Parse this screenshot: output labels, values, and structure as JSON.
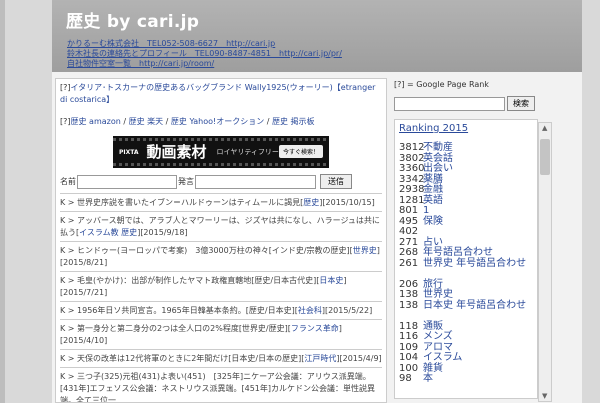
{
  "header": {
    "title": "歴史 by cari.jp",
    "links": [
      "かりるーむ株式会社　TEL052-508-6627　http://cari.jp",
      "鈴木社長の連絡先とプロフィール　TEL090-8487-4851　http://cari.jp/pr/",
      "自社物件空室一覧　http://cari.jp/room/"
    ]
  },
  "main": {
    "promo_prefix": "[?]",
    "promo_link": "イタリア･トスカーナの歴史あるバッグブランド Wally1925(ウォーリー)【etranger di costarica】",
    "amazon_links": {
      "prefix": "[?]",
      "items": [
        "歴史 amazon",
        "歴史 楽天",
        "歴史 Yahoo!オークション",
        "歴史 掲示板"
      ],
      "sep": " / "
    },
    "banner": {
      "brand": "PIXTA",
      "main": "動画素材",
      "sub": "ロイヤリティフリー",
      "button": "今すぐ検索！"
    },
    "form": {
      "name_label": "名前",
      "say_label": "発言",
      "send_label": "送信"
    },
    "posts": [
      {
        "text": "K > 世界史序説を書いたイブン＝ハルドゥーンはティムールに謁見",
        "link": "歴史",
        "tail": "[2015/10/15]"
      },
      {
        "text": "K > アッバース朝では、アラブ人とマワーリーは、ジズヤは共になし、ハラージュは共に払う",
        "link": "イスラム教 歴史",
        "tail": "[2015/9/18]"
      },
      {
        "text": "K > ヒンドゥー(ヨーロッパで考案)　3億3000万柱の神々[インド史/宗教の歴史]",
        "link": "世界史",
        "tail": "[2015/8/21]"
      },
      {
        "text": "K > 毛皇(やかけ)：出部が制作したヤマト政権直轄地[歴史/日本古代史]",
        "link": "日本史",
        "tail": "[2015/7/21]"
      },
      {
        "text": "K > 1956年日ソ共同宣言。1965年日韓基本条約。[歴史/日本史]",
        "link": "社会科",
        "tail": "[2015/5/22]"
      },
      {
        "text": "K > 第一身分と第二身分の2つは全人口の2%程度[世界史/歴史]",
        "link": "フランス革命",
        "tail": "[2015/4/10]"
      },
      {
        "text": "K > 天保の改革は12代将軍のときに2年間だけ[日本史/日本の歴史]",
        "link": "江戸時代",
        "tail": "[2015/4/9]"
      },
      {
        "text": "K > 三つ子(325)元祖(431)よ表い(451)　[325年]ニケーア公会議：アリウス派異端。[431年]エフェソス公会議：ネストリウス派異端。[451年]カルケドン公会議：単性説異端。全て三位一",
        "link": "",
        "tail": ""
      }
    ]
  },
  "sidebar": {
    "note": "[?] = Google Page Rank",
    "search_button": "検索",
    "ranking_title": "Ranking 2015",
    "ranking": [
      {
        "count": "3812",
        "label": "不動産"
      },
      {
        "count": "3802",
        "label": "英会話"
      },
      {
        "count": "3360",
        "label": "出会い"
      },
      {
        "count": "3342",
        "label": "薬膳"
      },
      {
        "count": "2938",
        "label": "金融"
      },
      {
        "count": "1281",
        "label": "英語"
      },
      {
        "count": "801",
        "label": "1"
      },
      {
        "count": "495",
        "label": "保険"
      },
      {
        "count": "402",
        "label": ""
      },
      {
        "count": "271",
        "label": "占い"
      },
      {
        "count": "268",
        "label": "年号語呂合わせ"
      },
      {
        "count": "261",
        "label": "世界史 年号語呂合わせ"
      },
      {
        "count": "",
        "label": ""
      },
      {
        "count": "206",
        "label": "旅行"
      },
      {
        "count": "138",
        "label": "世界史"
      },
      {
        "count": "138",
        "label": "日本史 年号語呂合わせ"
      },
      {
        "count": "",
        "label": ""
      },
      {
        "count": "118",
        "label": "通販"
      },
      {
        "count": "116",
        "label": "メンズ"
      },
      {
        "count": "109",
        "label": "アロマ"
      },
      {
        "count": "104",
        "label": "イスラム"
      },
      {
        "count": "100",
        "label": "雑貨"
      },
      {
        "count": "98",
        "label": "本"
      }
    ]
  }
}
